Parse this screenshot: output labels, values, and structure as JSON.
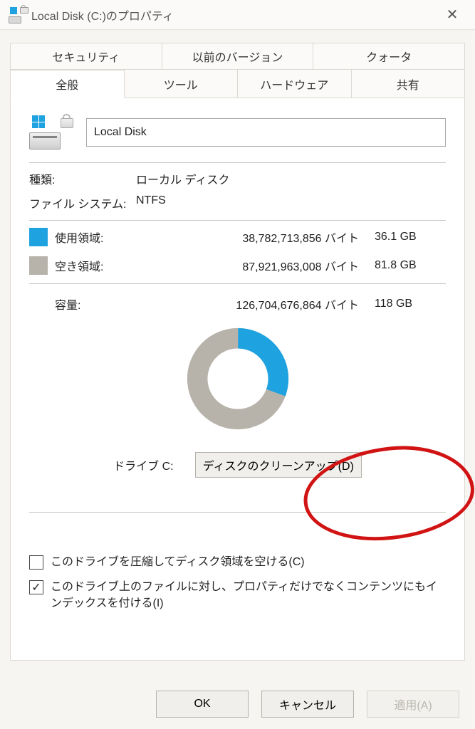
{
  "title": "Local Disk (C:)のプロパティ",
  "close_glyph": "✕",
  "tabsTop": [
    "セキュリティ",
    "以前のバージョン",
    "クォータ"
  ],
  "tabsBottom": [
    "全般",
    "ツール",
    "ハードウェア",
    "共有"
  ],
  "active_tab": "全般",
  "disk_name": "Local Disk",
  "kv": {
    "type_label": "種類:",
    "type_value": "ローカル ディスク",
    "fs_label": "ファイル システム:",
    "fs_value": "NTFS"
  },
  "usage": {
    "used_label": "使用領域:",
    "used_bytes": "38,782,713,856 バイト",
    "used_gb": "36.1 GB",
    "free_label": "空き領域:",
    "free_bytes": "87,921,963,008 バイト",
    "free_gb": "81.8 GB"
  },
  "capacity": {
    "label": "容量:",
    "bytes": "126,704,676,864 バイト",
    "gb": "118 GB"
  },
  "drive_label": "ドライブ C:",
  "cleanup_button": "ディスクのクリーンアップ(D)",
  "checks": {
    "compress": "このドライブを圧縮してディスク領域を空ける(C)",
    "index": "このドライブ上のファイルに対し、プロパティだけでなくコンテンツにもインデックスを付ける(I)"
  },
  "check_glyph": "✓",
  "buttons": {
    "ok": "OK",
    "cancel": "キャンセル",
    "apply": "適用(A)"
  },
  "chart_data": {
    "type": "pie",
    "title": "",
    "series": [
      {
        "name": "使用領域",
        "value": 36.1,
        "unit": "GB",
        "color": "#1fa3e0"
      },
      {
        "name": "空き領域",
        "value": 81.8,
        "unit": "GB",
        "color": "#b7b3ab"
      }
    ],
    "total": {
      "label": "容量",
      "value": 118,
      "unit": "GB"
    }
  },
  "colors": {
    "used": "#1fa3e0",
    "free": "#b7b3ab"
  }
}
